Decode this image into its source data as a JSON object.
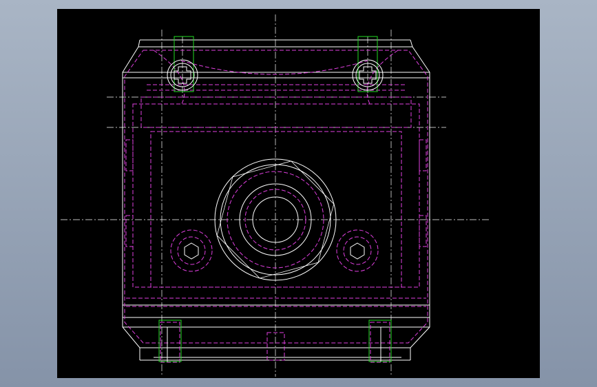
{
  "viewer": {
    "background": "#000000",
    "frame_background": "#97a4b8"
  },
  "drawing": {
    "view": "front-view",
    "line_colors": {
      "visible": "#ffffff",
      "hidden": "#e040e0",
      "screw": "#22dd22",
      "centerline": "#ffffff"
    },
    "features": [
      "body-outline",
      "center-port",
      "top-screws",
      "side-holes",
      "bottom-slots",
      "centerlines"
    ]
  }
}
